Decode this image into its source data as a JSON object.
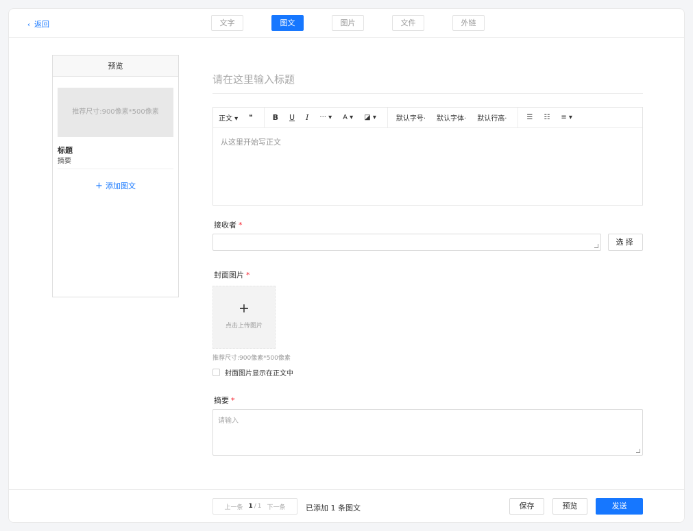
{
  "topbar": {
    "back_label": "返回",
    "tabs": [
      {
        "label": "文字",
        "active": false
      },
      {
        "label": "图文",
        "active": true
      },
      {
        "label": "图片",
        "active": false
      },
      {
        "label": "文件",
        "active": false
      },
      {
        "label": "外链",
        "active": false
      }
    ]
  },
  "preview": {
    "header": "预览",
    "image_hint": "推荐尺寸:900像素*500像素",
    "title": "标题",
    "summary": "摘要",
    "add_article": "添加图文"
  },
  "editor": {
    "title_placeholder": "请在这里输入标题",
    "toolbar": {
      "paragraph": "正文 ▾",
      "quote": "❝",
      "bold": "B",
      "underline": "U",
      "italic": "I",
      "more": "··· ▾",
      "font_color": "A ▾",
      "bg_color": "◪ ▾",
      "font_size": "默认字号·",
      "font_family": "默认字体·",
      "line_height": "默认行高·",
      "bullet_list": "☰",
      "ordered_list": "☷",
      "align": "≡ ▾"
    },
    "body_placeholder": "从这里开始写正文"
  },
  "receiver": {
    "label": "接收者",
    "required_mark": "*",
    "select_label": "选择"
  },
  "cover": {
    "label": "封面图片",
    "required_mark": "*",
    "upload_text": "点击上传图片",
    "hint": "推荐尺寸:900像素*500像素",
    "checkbox_label": "封面图片显示在正文中",
    "checked": false
  },
  "summary": {
    "label": "摘要",
    "required_mark": "*",
    "placeholder": "请输入"
  },
  "footer": {
    "prev": "上一条",
    "current_page": "1",
    "separator": "/",
    "total_pages": "1",
    "next": "下一条",
    "added_info": "已添加 1 条图文",
    "save": "保存",
    "preview": "预览",
    "send": "发送"
  },
  "colors": {
    "accent": "#1677ff",
    "required": "#f5222d",
    "background": "#f4f5f7"
  }
}
